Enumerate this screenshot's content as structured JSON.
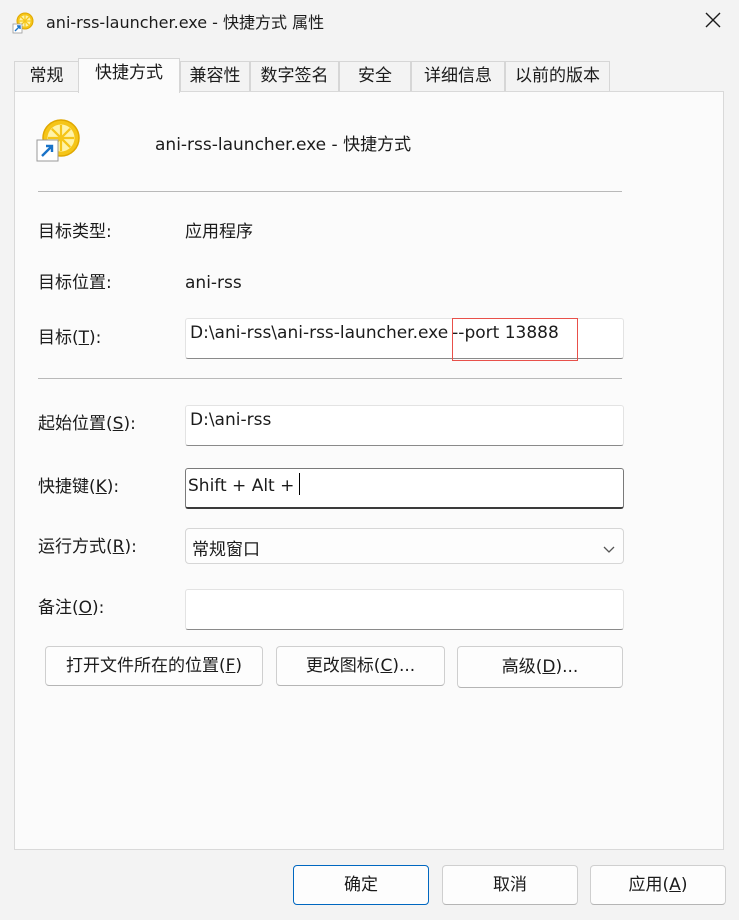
{
  "window": {
    "title": "ani-rss-launcher.exe - 快捷方式 属性",
    "icon": "lemon-shortcut-icon"
  },
  "tabs": [
    {
      "label": "常规",
      "active": false
    },
    {
      "label": "快捷方式",
      "active": true
    },
    {
      "label": "兼容性",
      "active": false
    },
    {
      "label": "数字签名",
      "active": false
    },
    {
      "label": "安全",
      "active": false
    },
    {
      "label": "详细信息",
      "active": false
    },
    {
      "label": "以前的版本",
      "active": false
    }
  ],
  "header": {
    "name": "ani-rss-launcher.exe - 快捷方式"
  },
  "info": {
    "target_type_label": "目标类型:",
    "target_type_value": "应用程序",
    "target_location_label": "目标位置:",
    "target_location_value": "ani-rss"
  },
  "fields": {
    "target_label_pre": "目标(",
    "target_label_key": "T",
    "target_label_post": "):",
    "target_value_main": "D:\\ani-rss\\ani-rss-launcher.exe",
    "target_value_arg": "--port 13888",
    "start_label_pre": "起始位置(",
    "start_label_key": "S",
    "start_label_post": "):",
    "start_value": "D:\\ani-rss",
    "hotkey_label_pre": "快捷键(",
    "hotkey_label_key": "K",
    "hotkey_label_post": "):",
    "hotkey_value": "Shift + Alt +",
    "run_label_pre": "运行方式(",
    "run_label_key": "R",
    "run_label_post": "):",
    "run_value": "常规窗口",
    "comment_label_pre": "备注(",
    "comment_label_key": "O",
    "comment_label_post": "):",
    "comment_value": ""
  },
  "action_buttons": {
    "open_location_pre": "打开文件所在的位置(",
    "open_location_key": "F",
    "open_location_post": ")",
    "change_icon_pre": "更改图标(",
    "change_icon_key": "C",
    "change_icon_post": ")...",
    "advanced_pre": "高级(",
    "advanced_key": "D",
    "advanced_post": ")..."
  },
  "footer": {
    "ok": "确定",
    "cancel": "取消",
    "apply_pre": "应用(",
    "apply_key": "A",
    "apply_post": ")"
  },
  "colors": {
    "accent": "#0067c0",
    "highlight_box": "#e8504a",
    "lemon": "#f5c518",
    "shortcut_arrow": "#1a73c8"
  }
}
